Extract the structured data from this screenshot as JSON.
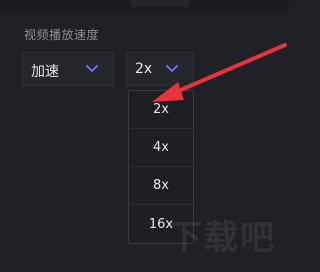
{
  "section": {
    "label": "视频播放速度"
  },
  "speed_mode": {
    "value": "加速"
  },
  "rate": {
    "value": "2x"
  },
  "dropdown": {
    "options": [
      "2x",
      "4x",
      "8x",
      "16x"
    ]
  },
  "watermark": {
    "text": "下载吧"
  },
  "colors": {
    "background": "#202127",
    "select_bg": "#24262c",
    "chevron": "#6f78ff",
    "annotation_arrow": "#e8323c"
  },
  "icons": {
    "chevron": "chevron-down-icon"
  }
}
